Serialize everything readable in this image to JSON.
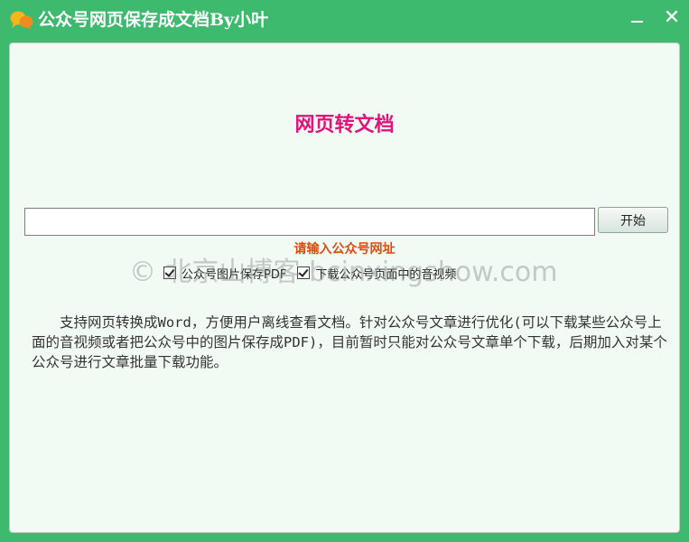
{
  "window": {
    "title": "公众号网页保存成文档By小叶",
    "minimize_symbol": "",
    "close_symbol": "✕"
  },
  "main": {
    "heading": "网页转文档",
    "url_input": {
      "value": "",
      "placeholder": ""
    },
    "start_button": "开始",
    "hint": "请输入公众号网址",
    "options": [
      {
        "label": "公众号图片保存PDF",
        "checked": true
      },
      {
        "label": "下载公众号页面中的音视频",
        "checked": true
      }
    ],
    "description": "支持网页转换成Word，方便用户离线查看文档。针对公众号文章进行优化(可以下载某些公众号上面的音视频或者把公众号中的图片保存成PDF)，目前暂时只能对公众号文章单个下载，后期加入对某个公众号进行文章批量下载功能。"
  },
  "watermark": "© 北京山博客 bcinxingshow.com",
  "colors": {
    "title_bar": "#3dba6e",
    "client_bg": "#f1fbf3",
    "heading": "#e0147a",
    "hint": "#e04a10"
  },
  "icons": {
    "app": "chat-bubbles-icon",
    "minimize": "minimize-icon",
    "close": "close-icon",
    "checkbox": "checkmark-icon"
  }
}
